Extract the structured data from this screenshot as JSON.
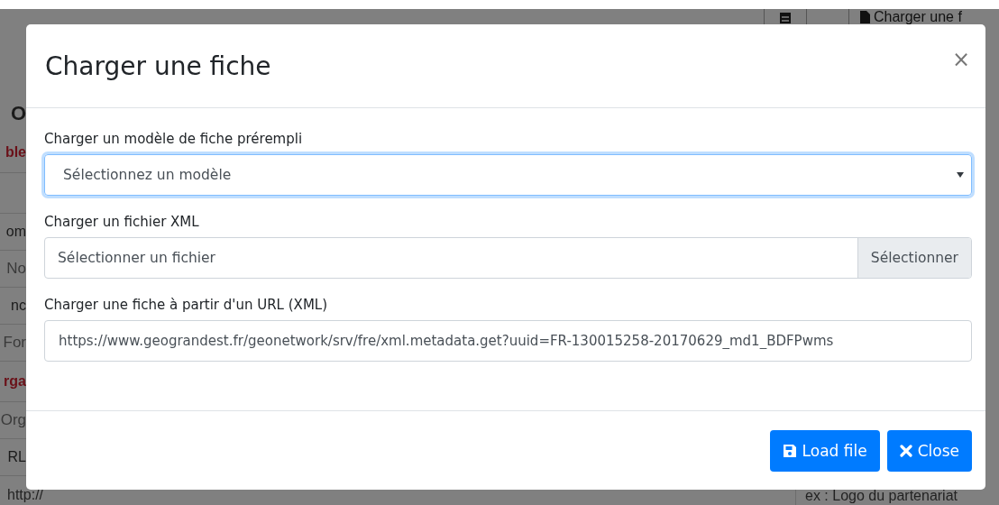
{
  "background": {
    "left_column": [
      {
        "text": "O",
        "kind": "heading"
      },
      {
        "text": "ble",
        "kind": "section"
      },
      {
        "text": "om",
        "kind": "label"
      },
      {
        "text": "No",
        "kind": "placeholder"
      },
      {
        "text": "nc",
        "kind": "label"
      },
      {
        "text": "For",
        "kind": "placeholder"
      },
      {
        "text": "rga",
        "kind": "section"
      },
      {
        "text": "Org",
        "kind": "placeholder"
      },
      {
        "text": "RL",
        "kind": "label"
      }
    ],
    "link": "http://",
    "toolbar_button": "Charger une f",
    "hint": "ex : Logo du partenariat"
  },
  "modal": {
    "title": "Charger une fiche",
    "close": "×",
    "fields": [
      {
        "kind": "select",
        "label": "Charger un modèle de fiche prérempli",
        "value": "Sélectionnez un modèle",
        "focused": true
      },
      {
        "kind": "file",
        "label": "Charger un fichier XML",
        "placeholder": "Sélectionner un fichier",
        "button": "Sélectionner",
        "focused": false
      },
      {
        "kind": "text",
        "label": "Charger une fiche à partir d'un URL (XML)",
        "value": "https://www.geograndest.fr/geonetwork/srv/fre/xml.metadata.get?uuid=FR-130015258-20170629_md1_BDFPwms",
        "focused": false
      }
    ],
    "buttons": [
      {
        "label": "Load file",
        "kind": "save"
      },
      {
        "label": "Close",
        "kind": "close"
      }
    ]
  }
}
